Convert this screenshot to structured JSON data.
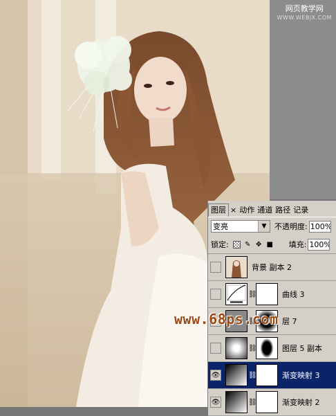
{
  "watermark_top": {
    "line1": "网页教学网",
    "line2": "WWW.WEBJX.COM"
  },
  "watermark_center": "www.68ps.com",
  "panel": {
    "tabs": [
      {
        "label": "图层"
      },
      {
        "label": "×"
      },
      {
        "label": "动作"
      },
      {
        "label": "通道"
      },
      {
        "label": "路径"
      },
      {
        "label": "记录"
      }
    ],
    "blend_mode": "变亮",
    "opacity_label": "不透明度:",
    "opacity_value": "100%",
    "lock_label": "锁定:",
    "fill_label": "填充:",
    "fill_value": "100%",
    "layers": [
      {
        "name": "背景 副本 2",
        "visible": false,
        "selected": false
      },
      {
        "name": "曲线 3",
        "visible": false,
        "selected": false
      },
      {
        "name": "层 7",
        "visible": false,
        "selected": false
      },
      {
        "name": "图层 5 副本",
        "visible": false,
        "selected": false
      },
      {
        "name": "渐变映射 3",
        "visible": true,
        "selected": true
      },
      {
        "name": "渐变映射 2",
        "visible": true,
        "selected": false
      }
    ]
  }
}
